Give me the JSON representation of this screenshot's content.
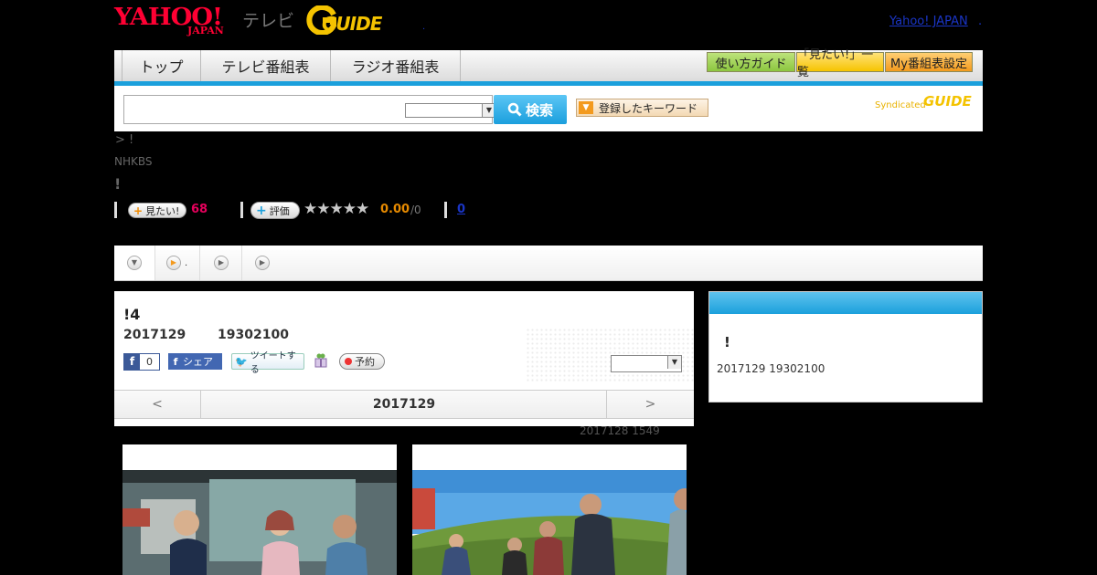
{
  "header": {
    "yahoo_logo": "YAHOO!",
    "yahoo_japan": "JAPAN",
    "tv_label": "テレビ",
    "gguide_logo": "GUIDE",
    "yahoo_japan_link": "Yahoo! JAPAN",
    "link_separator": "."
  },
  "nav": {
    "tabs": [
      "トップ",
      "テレビ番組表",
      "ラジオ番組表"
    ],
    "guide_buttons": [
      "使い方ガイド",
      "「見たい!」一覧",
      "My番組表設定"
    ]
  },
  "search": {
    "placeholder": "",
    "select_value": "",
    "search_button": "検索",
    "keyword_button": "登録したキーワード",
    "syndicated": "Syndicated",
    "syn_logo": "GUIDE"
  },
  "program": {
    "breadcrumb": "> !",
    "channel": "NHKBS",
    "title": "!",
    "mitai_label": "見たい!",
    "mitai_count": "68",
    "hyouka_label": "評価",
    "stars": "★★★★★",
    "rating": "0.00",
    "rating_den": "/0",
    "review_count": "0"
  },
  "tabs_row": {
    "tab2_suffix": "."
  },
  "episode": {
    "title": "!4",
    "date": "2017129",
    "time": "19302100",
    "fb_count": "0",
    "fb_share": "シェア",
    "tweet": "ツイートする",
    "yoyaku": "予約",
    "pager_prev": "<",
    "pager_current": "2017129",
    "pager_next": ">",
    "updated": "2017128  1549"
  },
  "side": {
    "title": "!",
    "text": "2017129  19302100"
  },
  "colors": {
    "accent_blue": "#1ba0dc",
    "yahoo_red": "#ff0033",
    "gguide_yellow": "#f4c300",
    "pink_count": "#e6005c",
    "orange_rating": "#e68a00"
  }
}
